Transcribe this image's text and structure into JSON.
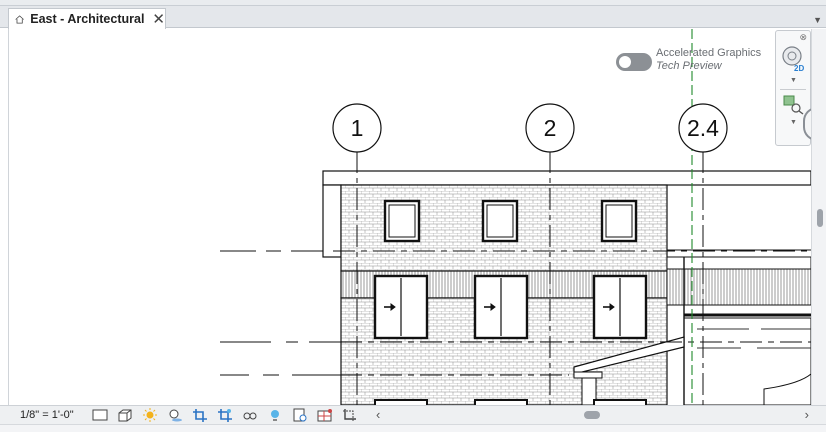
{
  "tab": {
    "title": "East - Architectural",
    "close_glyph": "✕"
  },
  "overlay": {
    "accel_title": "Accelerated Graphics",
    "accel_subtitle": "Tech Preview",
    "toggle_state": "off"
  },
  "grid_labels": [
    "1",
    "2",
    "2.4"
  ],
  "status": {
    "scale": "1/8\" = 1'-0\""
  },
  "icons": {
    "view_control": [
      "detail-level-icon",
      "visual-style-icon",
      "sun-path-icon",
      "shadows-icon",
      "crop-view-icon",
      "show-crop-region-icon",
      "temporary-hide-icon",
      "reveal-hidden-icon",
      "temporary-view-properties-icon",
      "analytical-model-icon",
      "highlight-displacement-icon"
    ],
    "navbar": [
      "steering-wheel-icon",
      "zoom-region-icon"
    ]
  },
  "colors": {
    "drawing_line": "#111111",
    "grid_line_green": "#1f8a2a",
    "background": "#ffffff"
  }
}
